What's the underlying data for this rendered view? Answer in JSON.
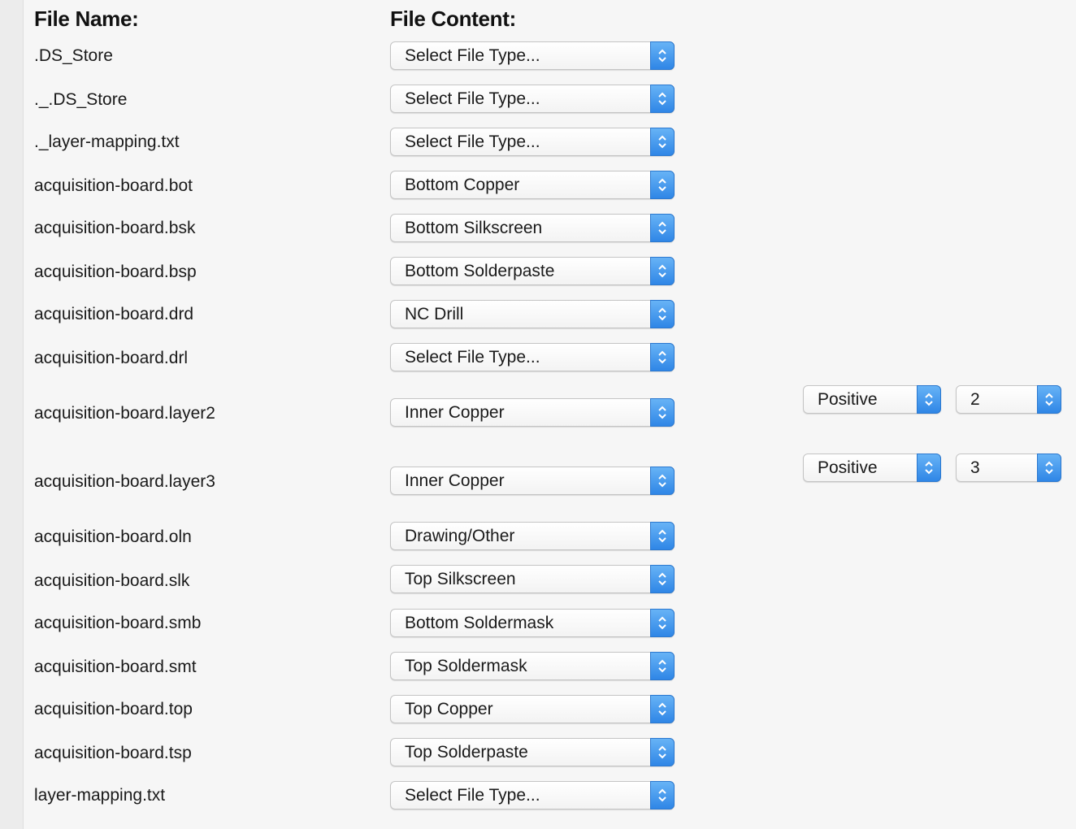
{
  "headers": {
    "file_name": "File Name:",
    "file_content": "File Content:"
  },
  "icons": {
    "dropdown_stepper": "chevron-up-down-icon"
  },
  "colors": {
    "stepper_accent": "#3b8ff0",
    "background": "#f6f6f6"
  },
  "rows": [
    {
      "file": ".DS_Store",
      "content": "Select File Type..."
    },
    {
      "file": "._.DS_Store",
      "content": "Select File Type..."
    },
    {
      "file": "._layer-mapping.txt",
      "content": "Select File Type..."
    },
    {
      "file": "acquisition-board.bot",
      "content": "Bottom Copper"
    },
    {
      "file": "acquisition-board.bsk",
      "content": "Bottom Silkscreen"
    },
    {
      "file": "acquisition-board.bsp",
      "content": "Bottom Solderpaste"
    },
    {
      "file": "acquisition-board.drd",
      "content": "NC Drill"
    },
    {
      "file": "acquisition-board.drl",
      "content": "Select File Type..."
    },
    {
      "file": "acquisition-board.layer2",
      "content": "Inner Copper",
      "polarity": "Positive",
      "layer": "2"
    },
    {
      "file": "acquisition-board.layer3",
      "content": "Inner Copper",
      "polarity": "Positive",
      "layer": "3"
    },
    {
      "file": "acquisition-board.oln",
      "content": "Drawing/Other"
    },
    {
      "file": "acquisition-board.slk",
      "content": "Top Silkscreen"
    },
    {
      "file": "acquisition-board.smb",
      "content": "Bottom Soldermask"
    },
    {
      "file": "acquisition-board.smt",
      "content": "Top Soldermask"
    },
    {
      "file": "acquisition-board.top",
      "content": "Top Copper"
    },
    {
      "file": "acquisition-board.tsp",
      "content": "Top Solderpaste"
    },
    {
      "file": "layer-mapping.txt",
      "content": "Select File Type..."
    }
  ]
}
